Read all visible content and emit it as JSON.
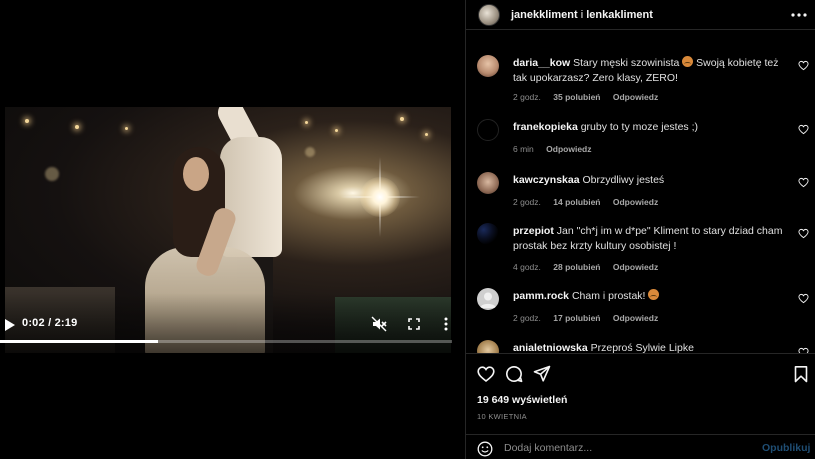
{
  "video": {
    "time": "0:02 / 2:19",
    "progress": 0.35
  },
  "header": {
    "user1": "janekkliment",
    "separator": "i",
    "user2": "lenkakliment"
  },
  "comments": [
    {
      "user": "daria__kow",
      "text_a": "Stary męski szowinista",
      "text_b": "Swoją kobietę też tak upokarzasz? Zero klasy, ZERO!",
      "time": "2 godz.",
      "likes": "35 polubień",
      "reply": "Odpowiedz"
    },
    {
      "user": "franekopieka",
      "text_a": "gruby to ty moze jestes ;)",
      "time": "6 min",
      "reply": "Odpowiedz"
    },
    {
      "user": "kawczynskaa",
      "text_a": "Obrzydliwy jesteś",
      "time": "2 godz.",
      "likes": "14 polubień",
      "reply": "Odpowiedz"
    },
    {
      "user": "przepiot",
      "text_a": "Jan \"ch*j im w d*pe\" Kliment to stary dziad cham prostak bez krzty kultury osobistej !",
      "time": "4 godz.",
      "likes": "28 polubień",
      "reply": "Odpowiedz"
    },
    {
      "user": "pamm.rock",
      "text_a": "Cham i prostak!",
      "time": "2 godz.",
      "likes": "17 polubień",
      "reply": "Odpowiedz"
    },
    {
      "user": "anialetniowska",
      "text_a": "Przeproś Sylwie Lipke"
    }
  ],
  "stats": {
    "views": "19 649 wyświetleń",
    "date": "10 KWIETNIA"
  },
  "composer": {
    "placeholder": "Dodaj komentarz...",
    "publish": "Opublikuj"
  },
  "icons": {
    "header_menu": "more-horizontal-icon",
    "like": "heart-icon",
    "comment": "comment-icon",
    "share": "send-icon",
    "save": "bookmark-icon",
    "emoji": "smiley-icon"
  }
}
